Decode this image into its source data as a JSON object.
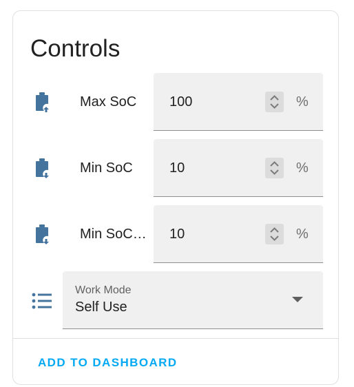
{
  "card": {
    "title": "Controls",
    "action_label": "ADD TO DASHBOARD"
  },
  "colors": {
    "icon": "#44739e",
    "accent": "#03a9f4",
    "field_bg": "#f0f0f0"
  },
  "rows": [
    {
      "icon": "battery-charging-up-icon",
      "label": "Max SoC",
      "value": "100",
      "unit": "%"
    },
    {
      "icon": "battery-charging-down-icon",
      "label": "Min SoC",
      "value": "10",
      "unit": "%"
    },
    {
      "icon": "battery-charging-down-icon",
      "label": "Min SoC…",
      "value": "10",
      "unit": "%"
    }
  ],
  "work_mode": {
    "icon": "format-list-bulleted-icon",
    "label": "Work Mode",
    "value": "Self Use"
  }
}
